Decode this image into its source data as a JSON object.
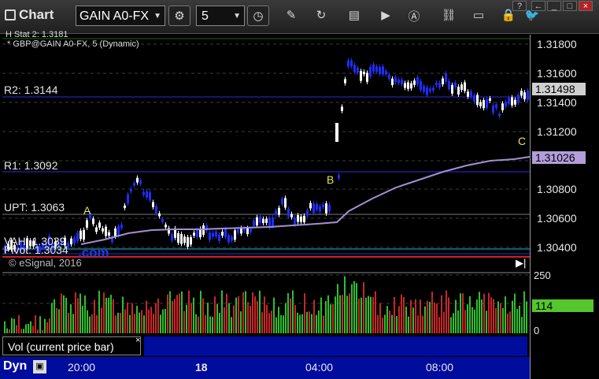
{
  "window": {
    "title": "Chart"
  },
  "toolbar": {
    "symbol": "GAIN A0-FX",
    "interval": "5"
  },
  "chart": {
    "study_title": "* GBP@GAIN A0-FX, 5 (Dynamic)",
    "top_clip": "H Stat 2: 1.3181",
    "levels": [
      {
        "label": "R2: 1.3144"
      },
      {
        "label": "R1: 1.3092"
      },
      {
        "label": "UPT: 1.3063"
      },
      {
        "label": "VAH: 1.3039"
      },
      {
        "label": "Pivot: 1.3034"
      }
    ],
    "dotcom": ".com",
    "copyright": "© eSignal, 2016",
    "points": {
      "a": "A",
      "b": "B",
      "c": "C"
    },
    "colors": {
      "up": "#ffffff",
      "down": "#1f2cff",
      "vwap": "#a48fd4",
      "line_blue": "#2a2ae0",
      "line_cyan": "#22b8d8",
      "line_red": "#d12121"
    }
  },
  "price_axis": {
    "ticks": [
      "1.31800",
      "1.31600",
      "1.31400",
      "1.31200",
      "1.30800",
      "1.30600",
      "1.30400"
    ],
    "last_price": "1.31498",
    "vwap_value": "1.31026"
  },
  "volume": {
    "tab_label": "Vol (current price bar)",
    "close_glyph": "×",
    "axis_top": "250",
    "axis_bottom": "0",
    "current": "114"
  },
  "time_axis": {
    "mode": "Dyn",
    "labels": [
      "20:00",
      "18",
      "04:00",
      "08:00"
    ]
  }
}
